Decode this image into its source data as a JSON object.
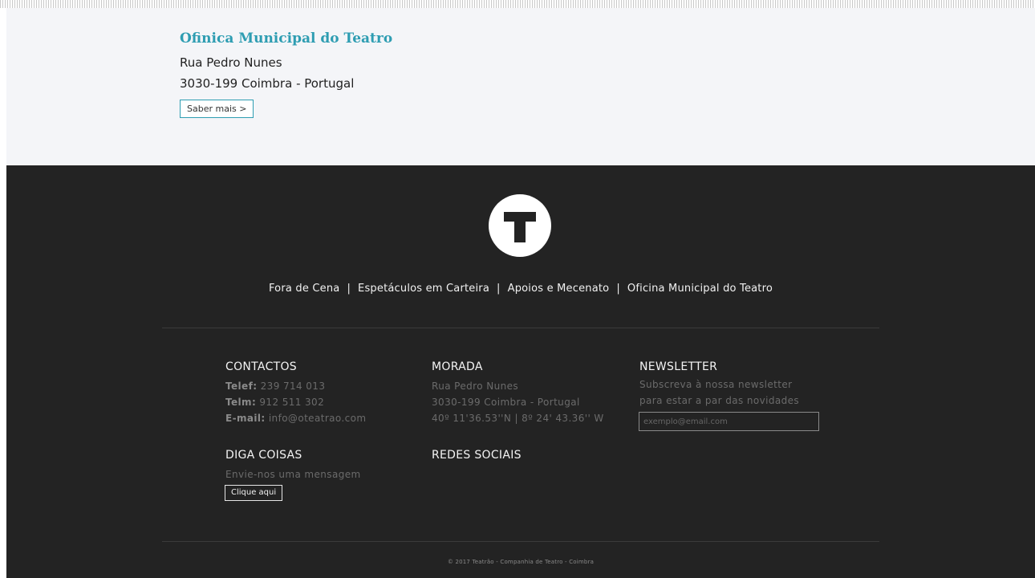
{
  "venue": {
    "title": "Ofinica Municipal do Teatro",
    "street": "Rua Pedro Nunes",
    "city": "3030-199 Coimbra - Portugal",
    "more_label": "Saber mais >"
  },
  "logo": {
    "letter": "T",
    "icon": "theatre-t-logo-icon"
  },
  "nav": {
    "items": [
      "Fora de Cena",
      "Espetáculos em Carteira",
      "Apoios e Mecenato",
      "Oficina Municipal do Teatro"
    ],
    "separator": "|"
  },
  "contactos": {
    "title": "CONTACTOS",
    "telef_label": "Telef:",
    "telef_value": "239 714 013",
    "telm_label": "Telm:",
    "telm_value": "912 511 302",
    "email_label": "E-mail:",
    "email_value": "info@oteatrao.com"
  },
  "morada": {
    "title": "MORADA",
    "street": "Rua Pedro Nunes",
    "city": "3030-199 Coimbra - Portugal",
    "coords": "40º 11'36.53''N | 8º 24' 43.36'' W"
  },
  "newsletter": {
    "title": "NEWSLETTER",
    "line1": "Subscreva à nossa newsletter",
    "line2": "para estar a par das novidades",
    "placeholder": "exemplo@email.com"
  },
  "diga": {
    "title": "DIGA COISAS",
    "text": "Envie-nos uma mensagem",
    "button_label": "Clique aqui"
  },
  "redes": {
    "title": "REDES SOCIAIS"
  },
  "copyright": "© 2017 Teatrão - Companhia de Teatro - Coimbra",
  "colors": {
    "accent": "#2e9db2",
    "footer_bg": "#232323",
    "top_bg": "#f4f5f8"
  }
}
